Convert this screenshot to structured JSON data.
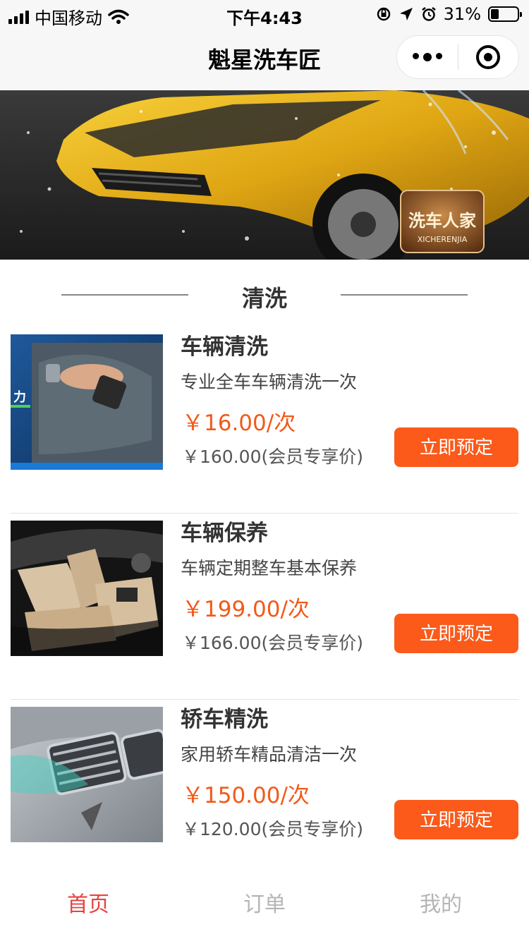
{
  "status_bar": {
    "carrier": "中国移动",
    "time": "下午4:43",
    "battery_percent": "31%",
    "battery_level": 0.31,
    "icons": [
      "signal-icon",
      "wifi-icon",
      "orientation-lock-icon",
      "location-icon",
      "alarm-icon",
      "battery-icon"
    ]
  },
  "nav": {
    "title": "魁星洗车匠",
    "more_icon": "more-dots-icon",
    "close_icon": "target-close-icon"
  },
  "banner": {
    "badge_text": "洗车人家",
    "badge_subtext": "XICHERENJIA"
  },
  "section": {
    "title": "清洗"
  },
  "services": [
    {
      "name": "车辆清洗",
      "desc": "专业全车车辆清洗一次",
      "price": "￥16.00/次",
      "member_price": "￥160.00(会员专享价)",
      "button": "立即预定",
      "thumb_text": "力"
    },
    {
      "name": "车辆保养",
      "desc": "车辆定期整车基本保养",
      "price": "￥199.00/次",
      "member_price": "￥166.00(会员专享价)",
      "button": "立即预定"
    },
    {
      "name": "轿车精洗",
      "desc": "家用轿车精品清洁一次",
      "price": "￥150.00/次",
      "member_price": "￥120.00(会员专享价)",
      "button": "立即预定"
    }
  ],
  "tabs": [
    {
      "label": "首页",
      "active": true
    },
    {
      "label": "订单",
      "active": false
    },
    {
      "label": "我的",
      "active": false
    }
  ],
  "colors": {
    "accent": "#fb5a1a",
    "price": "#f25a1a",
    "tab_active": "#e64340",
    "tab_inactive": "#b5b5b5"
  }
}
